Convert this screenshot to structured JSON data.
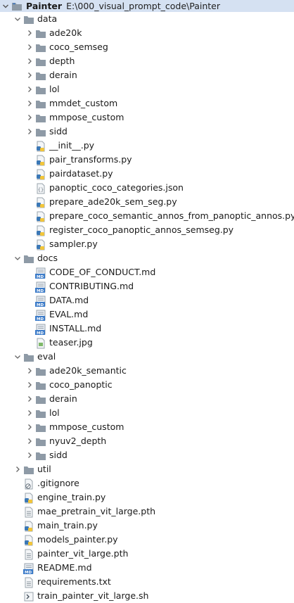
{
  "project": {
    "name": "Painter",
    "path": "E:\\000_visual_prompt_code\\Painter"
  },
  "colors": {
    "selection": "#d5e1f2",
    "folder": "#8e9aa6",
    "python_blue": "#3b78b6",
    "python_yellow": "#f2c53a",
    "md_badge": "#3d7cc9"
  },
  "tree": [
    {
      "label": "data",
      "type": "folder",
      "depth": 1,
      "open": true
    },
    {
      "label": "ade20k",
      "type": "folder",
      "depth": 2,
      "open": false
    },
    {
      "label": "coco_semseg",
      "type": "folder",
      "depth": 2,
      "open": false
    },
    {
      "label": "depth",
      "type": "folder",
      "depth": 2,
      "open": false
    },
    {
      "label": "derain",
      "type": "folder",
      "depth": 2,
      "open": false
    },
    {
      "label": "lol",
      "type": "folder",
      "depth": 2,
      "open": false
    },
    {
      "label": "mmdet_custom",
      "type": "folder",
      "depth": 2,
      "open": false
    },
    {
      "label": "mmpose_custom",
      "type": "folder",
      "depth": 2,
      "open": false
    },
    {
      "label": "sidd",
      "type": "folder",
      "depth": 2,
      "open": false
    },
    {
      "label": "__init__.py",
      "type": "py",
      "depth": 2
    },
    {
      "label": "pair_transforms.py",
      "type": "py",
      "depth": 2
    },
    {
      "label": "pairdataset.py",
      "type": "py",
      "depth": 2
    },
    {
      "label": "panoptic_coco_categories.json",
      "type": "json",
      "depth": 2
    },
    {
      "label": "prepare_ade20k_sem_seg.py",
      "type": "py",
      "depth": 2
    },
    {
      "label": "prepare_coco_semantic_annos_from_panoptic_annos.py",
      "type": "py",
      "depth": 2
    },
    {
      "label": "register_coco_panoptic_annos_semseg.py",
      "type": "py",
      "depth": 2
    },
    {
      "label": "sampler.py",
      "type": "py",
      "depth": 2
    },
    {
      "label": "docs",
      "type": "folder",
      "depth": 1,
      "open": true
    },
    {
      "label": "CODE_OF_CONDUCT.md",
      "type": "md",
      "depth": 2
    },
    {
      "label": "CONTRIBUTING.md",
      "type": "md",
      "depth": 2
    },
    {
      "label": "DATA.md",
      "type": "md",
      "depth": 2
    },
    {
      "label": "EVAL.md",
      "type": "md",
      "depth": 2
    },
    {
      "label": "INSTALL.md",
      "type": "md",
      "depth": 2
    },
    {
      "label": "teaser.jpg",
      "type": "img",
      "depth": 2
    },
    {
      "label": "eval",
      "type": "folder",
      "depth": 1,
      "open": true
    },
    {
      "label": "ade20k_semantic",
      "type": "folder",
      "depth": 2,
      "open": false
    },
    {
      "label": "coco_panoptic",
      "type": "folder",
      "depth": 2,
      "open": false
    },
    {
      "label": "derain",
      "type": "folder",
      "depth": 2,
      "open": false
    },
    {
      "label": "lol",
      "type": "folder",
      "depth": 2,
      "open": false
    },
    {
      "label": "mmpose_custom",
      "type": "folder",
      "depth": 2,
      "open": false
    },
    {
      "label": "nyuv2_depth",
      "type": "folder",
      "depth": 2,
      "open": false
    },
    {
      "label": "sidd",
      "type": "folder",
      "depth": 2,
      "open": false
    },
    {
      "label": "util",
      "type": "folder",
      "depth": 1,
      "open": false
    },
    {
      "label": ".gitignore",
      "type": "ignore",
      "depth": 1
    },
    {
      "label": "engine_train.py",
      "type": "py",
      "depth": 1
    },
    {
      "label": "mae_pretrain_vit_large.pth",
      "type": "file",
      "depth": 1
    },
    {
      "label": "main_train.py",
      "type": "py",
      "depth": 1
    },
    {
      "label": "models_painter.py",
      "type": "py",
      "depth": 1
    },
    {
      "label": "painter_vit_large.pth",
      "type": "file",
      "depth": 1
    },
    {
      "label": "README.md",
      "type": "md",
      "depth": 1
    },
    {
      "label": "requirements.txt",
      "type": "file",
      "depth": 1
    },
    {
      "label": "train_painter_vit_large.sh",
      "type": "sh",
      "depth": 1
    }
  ]
}
